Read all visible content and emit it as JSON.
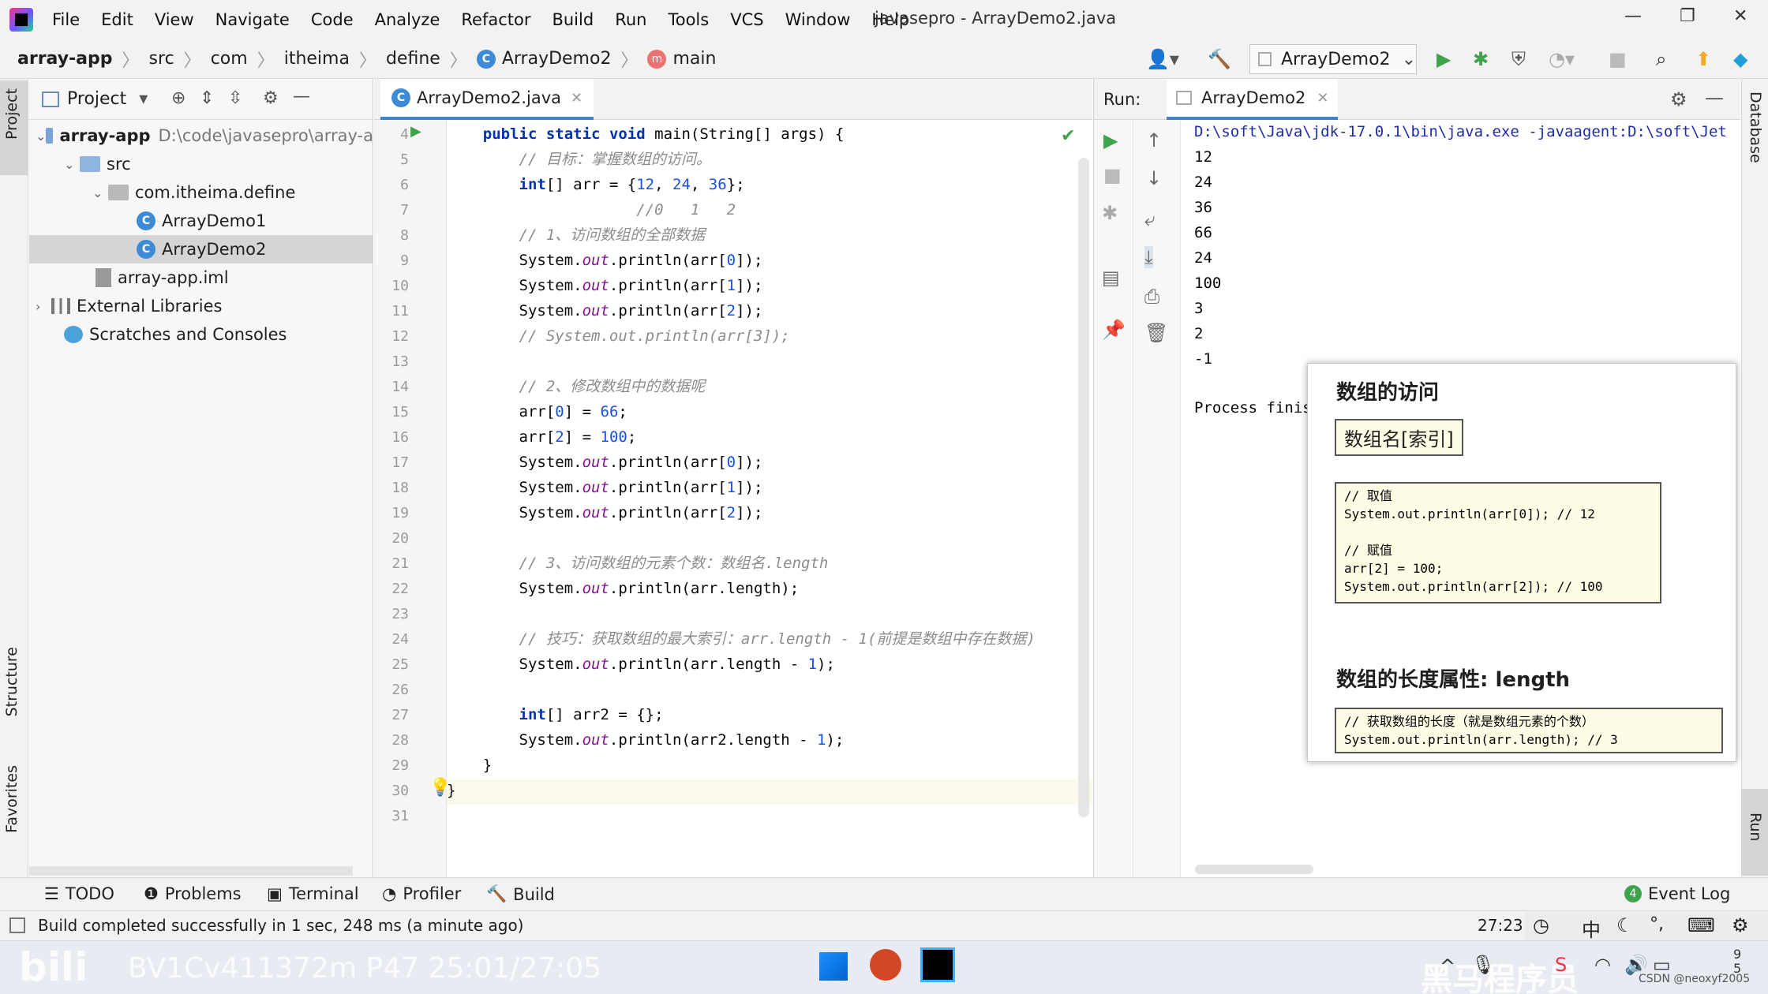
{
  "menu": [
    "File",
    "Edit",
    "View",
    "Navigate",
    "Code",
    "Analyze",
    "Refactor",
    "Build",
    "Run",
    "Tools",
    "VCS",
    "Window",
    "Help"
  ],
  "window_title": "javasepro - ArrayDemo2.java",
  "breadcrumb": [
    "array-app",
    "src",
    "com",
    "itheima",
    "define",
    "ArrayDemo2",
    "main"
  ],
  "run_config": "ArrayDemo2",
  "left_tabs": {
    "project": "Project",
    "structure": "Structure",
    "favorites": "Favorites"
  },
  "right_tabs": {
    "database": "Database",
    "run": "Run"
  },
  "project": {
    "header": "Project",
    "tree": [
      {
        "label": "array-app",
        "extra": "D:\\code\\javasepro\\array-a"
      },
      {
        "label": "src"
      },
      {
        "label": "com.itheima.define"
      },
      {
        "label": "ArrayDemo1"
      },
      {
        "label": "ArrayDemo2"
      },
      {
        "label": "array-app.iml"
      },
      {
        "label": "External Libraries"
      },
      {
        "label": "Scratches and Consoles"
      }
    ]
  },
  "editor": {
    "tab": "ArrayDemo2.java",
    "lines": [
      {
        "n": "4",
        "code": "    public static void main(String[] args) {"
      },
      {
        "n": "5",
        "code": "        // 目标：掌握数组的访问。"
      },
      {
        "n": "6",
        "code": "        int[] arr = {12, 24, 36};"
      },
      {
        "n": "7",
        "code": "                     //0   1   2"
      },
      {
        "n": "8",
        "code": "        // 1、访问数组的全部数据"
      },
      {
        "n": "9",
        "code": "        System.out.println(arr[0]);"
      },
      {
        "n": "10",
        "code": "        System.out.println(arr[1]);"
      },
      {
        "n": "11",
        "code": "        System.out.println(arr[2]);"
      },
      {
        "n": "12",
        "code": "        // System.out.println(arr[3]);"
      },
      {
        "n": "13",
        "code": ""
      },
      {
        "n": "14",
        "code": "        // 2、修改数组中的数据呢"
      },
      {
        "n": "15",
        "code": "        arr[0] = 66;"
      },
      {
        "n": "16",
        "code": "        arr[2] = 100;"
      },
      {
        "n": "17",
        "code": "        System.out.println(arr[0]);"
      },
      {
        "n": "18",
        "code": "        System.out.println(arr[1]);"
      },
      {
        "n": "19",
        "code": "        System.out.println(arr[2]);"
      },
      {
        "n": "20",
        "code": ""
      },
      {
        "n": "21",
        "code": "        // 3、访问数组的元素个数：数组名.length"
      },
      {
        "n": "22",
        "code": "        System.out.println(arr.length);"
      },
      {
        "n": "23",
        "code": ""
      },
      {
        "n": "24",
        "code": "        // 技巧：获取数组的最大索引：arr.length - 1(前提是数组中存在数据)"
      },
      {
        "n": "25",
        "code": "        System.out.println(arr.length - 1);"
      },
      {
        "n": "26",
        "code": ""
      },
      {
        "n": "27",
        "code": "        int[] arr2 = {};"
      },
      {
        "n": "28",
        "code": "        System.out.println(arr2.length - 1);"
      },
      {
        "n": "29",
        "code": "    }"
      },
      {
        "n": "30",
        "code": "}"
      },
      {
        "n": "31",
        "code": ""
      }
    ]
  },
  "run": {
    "label": "Run:",
    "tab": "ArrayDemo2",
    "command": "D:\\soft\\Java\\jdk-17.0.1\\bin\\java.exe -javaagent:D:\\soft\\Jet",
    "output": [
      "12",
      "24",
      "36",
      "66",
      "24",
      "100",
      "3",
      "2",
      "-1"
    ],
    "finish": "Process finis"
  },
  "slide": {
    "heading1": "数组的访问",
    "syntax": "数组名[索引]",
    "code1": "// 取值\nSystem.out.println(arr[0]); // 12\n\n// 赋值\narr[2] = 100;\nSystem.out.println(arr[2]); // 100",
    "heading2": "数组的长度属性: length",
    "code2": "// 获取数组的长度（就是数组元素的个数）\nSystem.out.println(arr.length); // 3"
  },
  "toolwindows": [
    "TODO",
    "Problems",
    "Terminal",
    "Profiler",
    "Build"
  ],
  "event_log": "Event Log",
  "status": {
    "message": "Build completed successfully in 1 sec, 248 ms (a minute ago)",
    "position": "27:23"
  },
  "ime": "中",
  "watermark_right": "黑马程序员",
  "watermark_left": "BV1Cv411372m P47 25:01/27:05",
  "credit": "CSDN @neoxyf2005",
  "clock": "9\n5"
}
